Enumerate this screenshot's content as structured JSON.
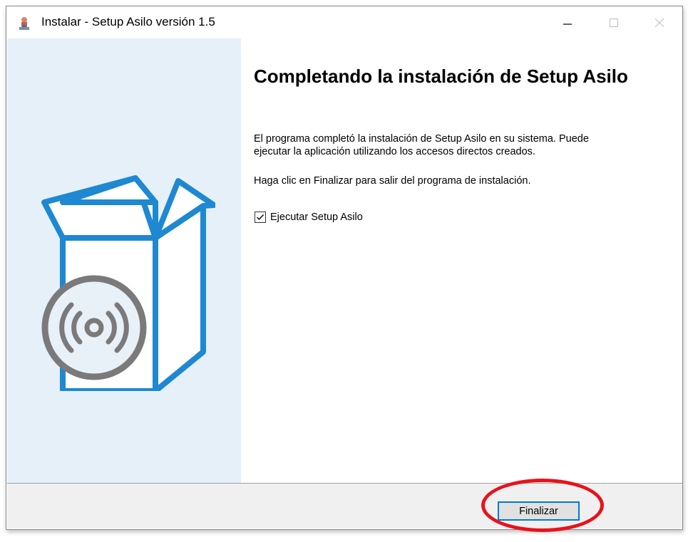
{
  "window": {
    "title": "Instalar - Setup Asilo versión 1.5",
    "controls": {
      "minimize_icon": "minimize-icon",
      "maximize_icon": "maximize-icon",
      "close_icon": "close-icon"
    }
  },
  "sidebar": {
    "illustration_icon": "box-disc-icon",
    "background_color": "#e6f0f9",
    "accent_color": "#1e88d1"
  },
  "main": {
    "heading": "Completando la instalación de Setup Asilo",
    "paragraph1_line1": "El programa completó la instalación de Setup Asilo en su sistema. Puede",
    "paragraph1_line2": "ejecutar la aplicación utilizando los accesos directos creados.",
    "paragraph2": "Haga clic en Finalizar para salir del programa de instalación.",
    "checkbox": {
      "label": "Ejecutar Setup Asilo",
      "checked": true
    }
  },
  "footer": {
    "finish_label": "Finalizar"
  },
  "annotation": {
    "color": "#e8121a"
  }
}
